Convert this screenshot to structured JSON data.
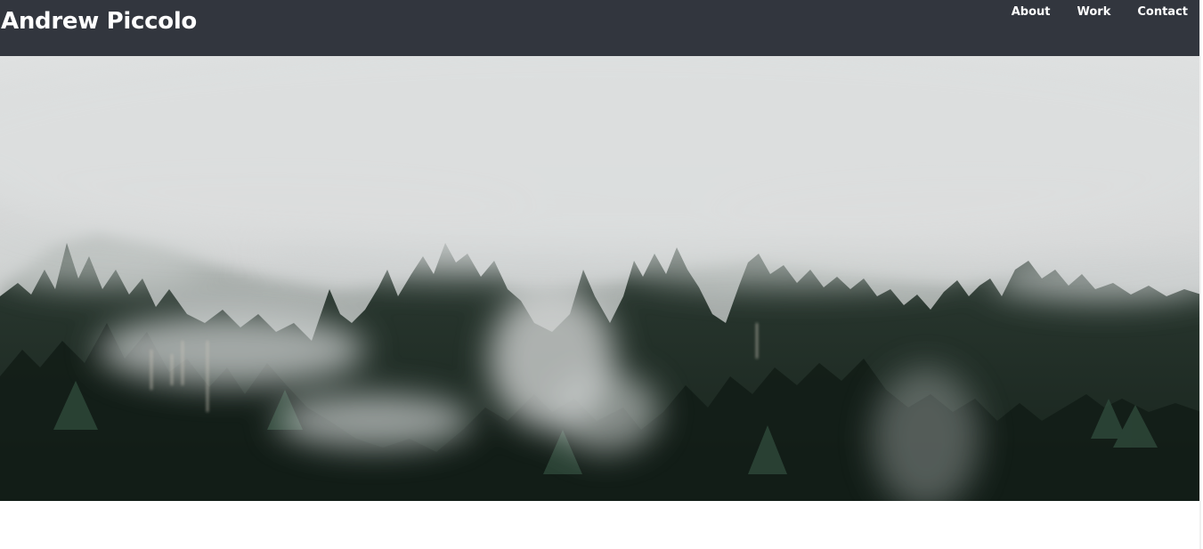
{
  "header": {
    "title": "Andrew Piccolo",
    "nav": [
      {
        "label": "About"
      },
      {
        "label": "Work"
      },
      {
        "label": "Contact"
      }
    ]
  },
  "hero": {
    "image": "misty-forest-photo"
  },
  "colors": {
    "header_bg": "#32363e",
    "header_text": "#ffffff",
    "fog": "#d6d8d8",
    "forest": "#1c2a22"
  }
}
